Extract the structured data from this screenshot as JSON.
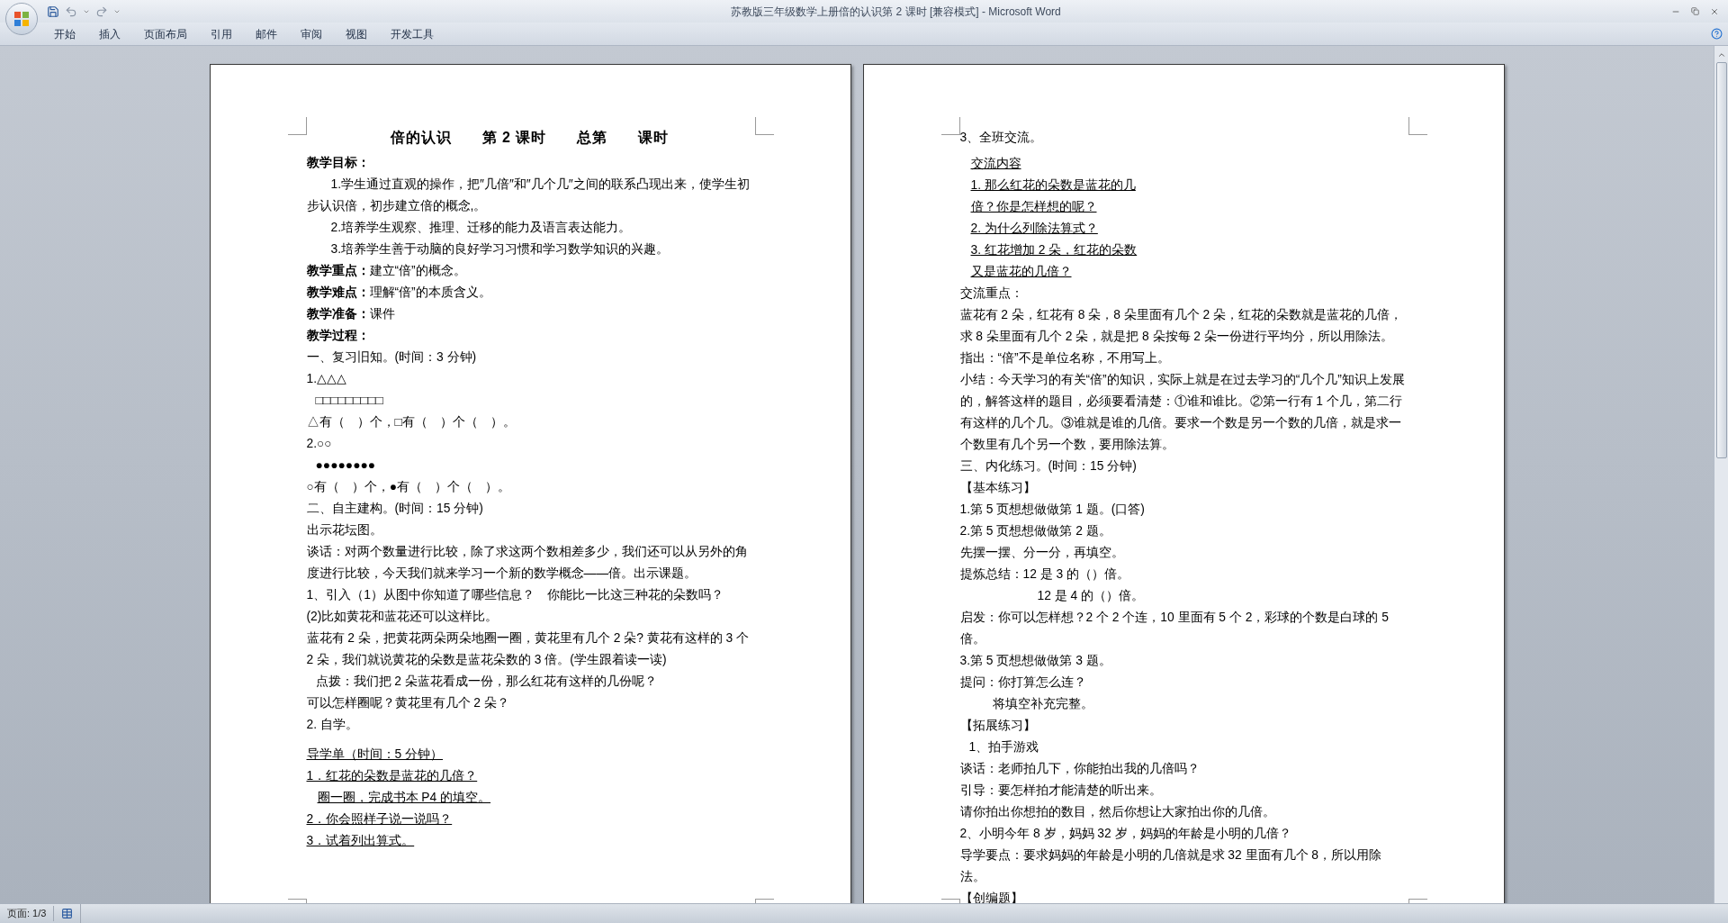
{
  "window": {
    "title": "苏教版三年级数学上册倍的认识第 2 课时 [兼容模式] - Microsoft Word"
  },
  "ribbon_tabs": [
    {
      "label": "开始"
    },
    {
      "label": "插入"
    },
    {
      "label": "页面布局"
    },
    {
      "label": "引用"
    },
    {
      "label": "邮件"
    },
    {
      "label": "审阅"
    },
    {
      "label": "视图"
    },
    {
      "label": "开发工具"
    }
  ],
  "pages": [
    {
      "paragraphs": [
        {
          "kind": "title",
          "text": "倍的认识　　第 2 课时　　总第　　课时"
        },
        {
          "kind": "label",
          "text": "教学目标："
        },
        {
          "kind": "first-indent",
          "text": "1.学生通过直观的操作，把″几倍″和″几个几″之间的联系凸现出来，使学生初步认识倍，初步建立倍的概念,。"
        },
        {
          "kind": "first-indent",
          "text": "2.培养学生观察、推理、迁移的能力及语言表达能力。"
        },
        {
          "kind": "first-indent",
          "text": "3.培养学生善于动脑的良好学习习惯和学习数学知识的兴趣。"
        },
        {
          "kind": "text",
          "text": "**教学重点：**建立“倍”的概念。"
        },
        {
          "kind": "text",
          "text": "**教学难点：**理解“倍”的本质含义。"
        },
        {
          "kind": "text",
          "text": "**教学准备：**课件"
        },
        {
          "kind": "label",
          "text": "教学过程："
        },
        {
          "kind": "text",
          "text": "一、复习旧知。(时间：3 分钟)"
        },
        {
          "kind": "text",
          "text": "1.△△△"
        },
        {
          "kind": "offset-sm",
          "text": "□□□□□□□□□"
        },
        {
          "kind": "text",
          "text": "△有（　）个，□有（　）个（　）。"
        },
        {
          "kind": "text",
          "text": "2.○○"
        },
        {
          "kind": "offset-sm",
          "text": "●●●●●●●●"
        },
        {
          "kind": "text",
          "text": "○有（　）个，●有（　）个（　）。"
        },
        {
          "kind": "text",
          "text": "二、自主建构。(时间：15 分钟)"
        },
        {
          "kind": "text",
          "text": "出示花坛图。"
        },
        {
          "kind": "text",
          "text": "谈话：对两个数量进行比较，除了求这两个数相差多少，我们还可以从另外的角度进行比较，今天我们就来学习一个新的数学概念——倍。出示课题。"
        },
        {
          "kind": "text",
          "text": "1、引入（1）从图中你知道了哪些信息？　你能比一比这三种花的朵数吗？"
        },
        {
          "kind": "text",
          "text": "(2)比如黄花和蓝花还可以这样比。"
        },
        {
          "kind": "text",
          "text": "蓝花有 2 朵，把黄花两朵两朵地圈一圈，黄花里有几个 2 朵? 黄花有这样的 3 个 2 朵，我们就说黄花的朵数是蓝花朵数的 3 倍。(学生跟着读一读)"
        },
        {
          "kind": "offset-sm",
          "text": "点拨：我们把 2 朵蓝花看成一份，那么红花有这样的几份呢？"
        },
        {
          "kind": "text",
          "text": "可以怎样圈呢？黄花里有几个 2 朵？"
        },
        {
          "kind": "text",
          "text": "2. 自学。"
        },
        {
          "kind": "underline",
          "text": "导学单（时间：5 分钟）"
        },
        {
          "kind": "underline",
          "text": "1．红花的朵数是蓝花的几倍？"
        },
        {
          "kind": "underline-offset",
          "text": "圈一圈，完成书本 P4 的填空。"
        },
        {
          "kind": "underline",
          "text": "2．你会照样子说一说吗？"
        },
        {
          "kind": "underline",
          "text": "3．试着列出算式。"
        }
      ]
    },
    {
      "paragraphs": [
        {
          "kind": "text",
          "text": "3、全班交流。"
        },
        {
          "kind": "underline-offset",
          "text": "交流内容"
        },
        {
          "kind": "underline-offset",
          "text": "1. 那么红花的朵数是蓝花的几"
        },
        {
          "kind": "underline-offset",
          "text": "倍？你是怎样想的呢？"
        },
        {
          "kind": "underline-offset",
          "text": "2. 为什么列除法算式？"
        },
        {
          "kind": "underline-offset",
          "text": "3. 红花增加 2 朵，红花的朵数"
        },
        {
          "kind": "underline-offset",
          "text": "又是蓝花的几倍？"
        },
        {
          "kind": "text",
          "text": "交流重点："
        },
        {
          "kind": "text",
          "text": "蓝花有 2 朵，红花有 8 朵，8 朵里面有几个 2 朵，红花的朵数就是蓝花的几倍，求 8 朵里面有几个 2 朵，就是把 8 朵按每 2 朵一份进行平均分，所以用除法。"
        },
        {
          "kind": "text",
          "text": "指出：“倍”不是单位名称，不用写上。"
        },
        {
          "kind": "text",
          "text": "小结：今天学习的有关“倍”的知识，实际上就是在过去学习的“几个几”知识上发展的，解答这样的题目，必须要看清楚：①谁和谁比。②第一行有 1 个几，第二行有这样的几个几。③谁就是谁的几倍。要求一个数是另一个数的几倍，就是求一个数里有几个另一个数，要用除法算。"
        },
        {
          "kind": "text",
          "text": "三、内化练习。(时间：15 分钟)"
        },
        {
          "kind": "text",
          "text": "【基本练习】"
        },
        {
          "kind": "text",
          "text": "1.第 5 页想想做做第 1 题。(口答)"
        },
        {
          "kind": "text",
          "text": "2.第 5 页想想做做第 2 题。"
        },
        {
          "kind": "text",
          "text": "先摆一摆、分一分，再填空。"
        },
        {
          "kind": "text",
          "text": "提炼总结：12 是 3 的（）倍。"
        },
        {
          "kind": "offset-lg",
          "text": "12 是 4 的（）倍。"
        },
        {
          "kind": "text",
          "text": "启发：你可以怎样想？2 个 2 个连，10 里面有 5 个 2，彩球的个数是白球的 5 倍。"
        },
        {
          "kind": "text",
          "text": "3.第 5 页想想做做第 3 题。"
        },
        {
          "kind": "text",
          "text": "提问：你打算怎么连？"
        },
        {
          "kind": "offset-md",
          "text": "将填空补充完整。"
        },
        {
          "kind": "text",
          "text": "【拓展练习】"
        },
        {
          "kind": "offset-sm",
          "text": "1、拍手游戏"
        },
        {
          "kind": "text",
          "text": "谈话：老师拍几下，你能拍出我的几倍吗？"
        },
        {
          "kind": "text",
          "text": "引导：要怎样拍才能清楚的听出来。"
        },
        {
          "kind": "text",
          "text": "请你拍出你想拍的数目，然后你想让大家拍出你的几倍。"
        },
        {
          "kind": "text",
          "text": "2、小明今年 8 岁，妈妈 32 岁，妈妈的年龄是小明的几倍？"
        },
        {
          "kind": "text",
          "text": "导学要点：要求妈妈的年龄是小明的几倍就是求 32 里面有几个 8，所以用除法。"
        },
        {
          "kind": "text",
          "text": "【创编题】"
        }
      ]
    }
  ],
  "status_bar": {
    "page": "页面: 1/3"
  }
}
